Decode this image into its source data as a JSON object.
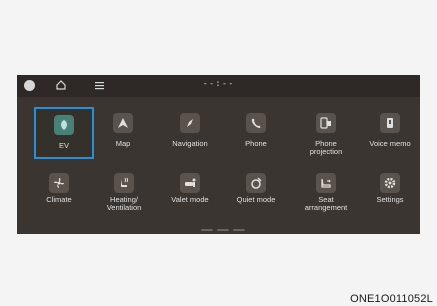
{
  "topbar": {
    "time": "--:--"
  },
  "apps": [
    {
      "id": "ev",
      "label": "EV",
      "icon": "leaf-icon",
      "selected": true
    },
    {
      "id": "map",
      "label": "Map",
      "icon": "map-arrow-icon",
      "selected": false
    },
    {
      "id": "navigation",
      "label": "Navigation",
      "icon": "compass-icon",
      "selected": false
    },
    {
      "id": "phone",
      "label": "Phone",
      "icon": "phone-icon",
      "selected": false
    },
    {
      "id": "phone-projection",
      "label": "Phone\nprojection",
      "icon": "phone-projection-icon",
      "selected": false
    },
    {
      "id": "voice-memo",
      "label": "Voice memo",
      "icon": "voice-memo-icon",
      "selected": false
    },
    {
      "id": "climate",
      "label": "Climate",
      "icon": "fan-icon",
      "selected": false
    },
    {
      "id": "heating-ventilation",
      "label": "Heating/\nVentilation",
      "icon": "seat-heat-icon",
      "selected": false
    },
    {
      "id": "valet-mode",
      "label": "Valet mode",
      "icon": "valet-icon",
      "selected": false
    },
    {
      "id": "quiet-mode",
      "label": "Quiet mode",
      "icon": "quiet-icon",
      "selected": false
    },
    {
      "id": "seat-arrangement",
      "label": "Seat\narrangement",
      "icon": "seat-icon",
      "selected": false
    },
    {
      "id": "settings",
      "label": "Settings",
      "icon": "gear-icon",
      "selected": false
    }
  ],
  "figure_code": "ONE1O011052L",
  "colors": {
    "accent": "#2a8fd6",
    "screen": "#3b3531",
    "tile_icon": "#5a524c"
  }
}
